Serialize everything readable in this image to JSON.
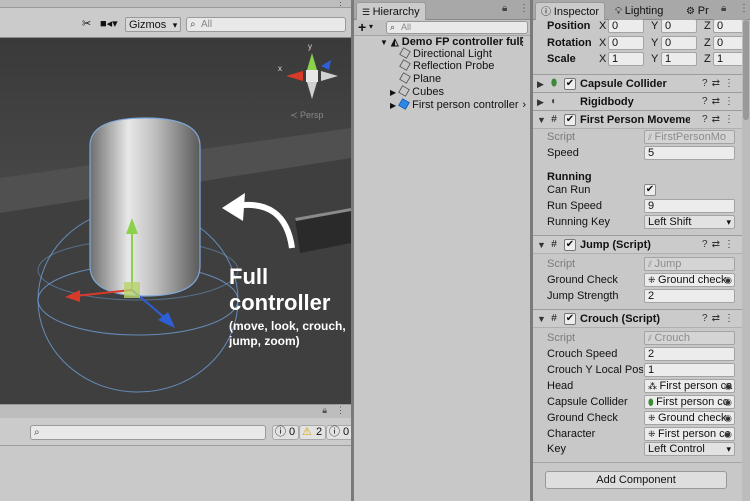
{
  "scene": {
    "toolbar": {
      "tools_icon": "crossed-tools-icon",
      "camera_icon": "camera-icon",
      "gizmos_label": "Gizmos",
      "search_placeholder": "All"
    },
    "persp_label": "≺ Persp",
    "gizmo_axis_labels": {
      "y": "y",
      "x": "x"
    },
    "overlay": {
      "title_line1": "Full",
      "title_line2": "controller",
      "subtitle_line1": "(move, look, crouch,",
      "subtitle_line2": "jump, zoom)"
    }
  },
  "console": {
    "info_count": "0",
    "warning_count": "2",
    "error_count": "0"
  },
  "hierarchy": {
    "tab_label": "Hierarchy",
    "add_label": "+",
    "search_placeholder": "All",
    "scene_name": "Demo FP controller full",
    "items": [
      {
        "label": "Directional Light"
      },
      {
        "label": "Reflection Probe"
      },
      {
        "label": "Plane"
      },
      {
        "label": "Cubes"
      },
      {
        "label": "First person controller"
      }
    ]
  },
  "inspector": {
    "tabs": [
      {
        "label": "Inspector"
      },
      {
        "label": "Lighting"
      },
      {
        "label": "Pr"
      }
    ],
    "transform": {
      "position": {
        "label": "Position",
        "x": "0",
        "y": "0",
        "z": "0"
      },
      "rotation": {
        "label": "Rotation",
        "x": "0",
        "y": "0",
        "z": "0"
      },
      "scale": {
        "label": "Scale",
        "x": "1",
        "y": "1",
        "z": "1"
      }
    },
    "capsule_collider": {
      "title": "Capsule Collider"
    },
    "rigidbody": {
      "title": "Rigidbody"
    },
    "movement": {
      "title": "First Person Movemen",
      "script_label": "Script",
      "script_value": "FirstPersonMo",
      "speed_label": "Speed",
      "speed_value": "5",
      "running_header": "Running",
      "can_run_label": "Can Run",
      "can_run_check": "✔",
      "run_speed_label": "Run Speed",
      "run_speed_value": "9",
      "running_key_label": "Running Key",
      "running_key_value": "Left Shift"
    },
    "jump": {
      "title": "Jump (Script)",
      "script_label": "Script",
      "script_value": "Jump",
      "ground_check_label": "Ground Check",
      "ground_check_value": "Ground check",
      "jump_strength_label": "Jump Strength",
      "jump_strength_value": "2"
    },
    "crouch": {
      "title": "Crouch (Script)",
      "script_label": "Script",
      "script_value": "Crouch",
      "crouch_speed_label": "Crouch Speed",
      "crouch_speed_value": "2",
      "crouch_y_label": "Crouch Y Local Posi",
      "crouch_y_value": "1",
      "head_label": "Head",
      "head_value": "First person ca",
      "capsule_label": "Capsule Collider",
      "capsule_value": "First person cc",
      "ground_check_label": "Ground Check",
      "ground_check_value": "Ground check",
      "character_label": "Character",
      "character_value": "First person cc",
      "key_label": "Key",
      "key_value": "Left Control"
    },
    "add_component_label": "Add Component"
  }
}
